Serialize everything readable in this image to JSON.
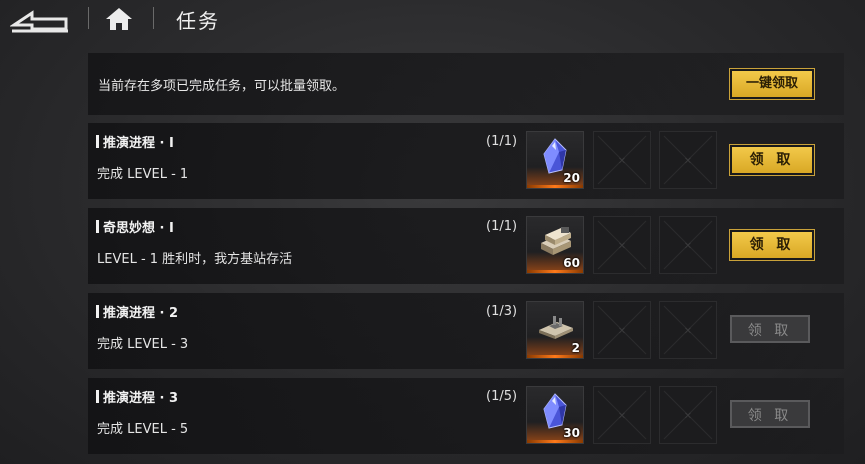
{
  "header": {
    "back_icon": "back-arrow-icon",
    "home_icon": "home-icon",
    "title": "任务"
  },
  "banner": {
    "text": "当前存在多项已完成任务，可以批量领取。",
    "button_label": "一键领取"
  },
  "tasks": [
    {
      "title": "推演进程 · Ⅰ",
      "desc": "完成 LEVEL - 1",
      "progress": "(1/1)",
      "reward": {
        "icon": "blue-crystal-icon",
        "count": "20"
      },
      "button_label": "领 取",
      "claimable": true
    },
    {
      "title": "奇思妙想 · Ⅰ",
      "desc": "LEVEL - 1 胜利时，我方基站存活",
      "progress": "(1/1)",
      "reward": {
        "icon": "metal-ingot-icon",
        "count": "60"
      },
      "button_label": "领 取",
      "claimable": true
    },
    {
      "title": "推演进程 · 2",
      "desc": "完成 LEVEL - 3",
      "progress": "(1/3)",
      "reward": {
        "icon": "circuit-chip-icon",
        "count": "2"
      },
      "button_label": "领 取",
      "claimable": false
    },
    {
      "title": "推演进程 · 3",
      "desc": "完成 LEVEL - 5",
      "progress": "(1/5)",
      "reward": {
        "icon": "blue-crystal-icon",
        "count": "30"
      },
      "button_label": "领 取",
      "claimable": false
    }
  ],
  "colors": {
    "gold": "#e8b935",
    "reward_glow": "#ff7a1a",
    "disabled": "#3a3a3c"
  }
}
